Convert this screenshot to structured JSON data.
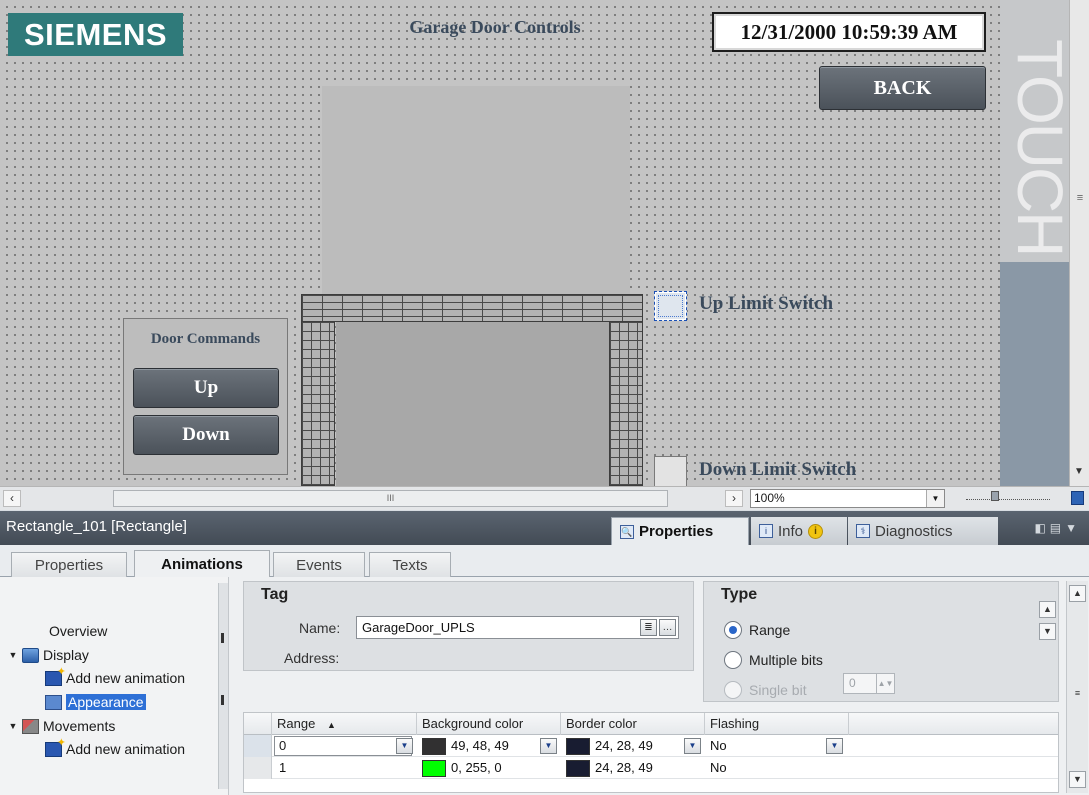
{
  "screen": {
    "logo_text": "SIEMENS",
    "title": "Garage Door Controls",
    "datetime": "12/31/2000 10:59:39 AM",
    "back_label": "BACK",
    "touch_label": "TOUCH",
    "door_commands": {
      "title": "Door Commands",
      "up_label": "Up",
      "down_label": "Down"
    },
    "up_limit_label": "Up Limit Switch",
    "down_limit_label": "Down Limit Switch"
  },
  "editor_bar": {
    "zoom": "100%",
    "grip": "III"
  },
  "inspector": {
    "object_title": "Rectangle_101 [Rectangle]",
    "tabs": [
      {
        "label": "Properties",
        "icon": "magnifier-properties-icon",
        "active": true
      },
      {
        "label": "Info",
        "icon": "info-icon",
        "badge": "i"
      },
      {
        "label": "Diagnostics",
        "icon": "diagnostics-icon"
      }
    ],
    "subtabs": [
      "Properties",
      "Animations",
      "Events",
      "Texts"
    ],
    "active_subtab": "Animations",
    "tree": {
      "overview": "Overview",
      "display": "Display",
      "display_add": "Add new animation",
      "appearance": "Appearance",
      "movements": "Movements",
      "movements_add": "Add new animation"
    },
    "tag_group": {
      "title": "Tag",
      "name_label": "Name:",
      "name_value": "GarageDoor_UPLS",
      "address_label": "Address:"
    },
    "type_group": {
      "title": "Type",
      "options": [
        "Range",
        "Multiple bits",
        "Single bit"
      ],
      "selected": "Range",
      "single_bit_value": "0"
    },
    "grid": {
      "columns": [
        "Range",
        "Background color",
        "Border color",
        "Flashing"
      ],
      "rows": [
        {
          "range": "0",
          "bg_color": "49, 48, 49",
          "bg_hex": "#313031",
          "border_color": "24, 28, 49",
          "border_hex": "#181c31",
          "flashing": "No"
        },
        {
          "range": "1",
          "bg_color": "0, 255, 0",
          "bg_hex": "#00ff00",
          "border_color": "24, 28, 49",
          "border_hex": "#181c31",
          "flashing": "No"
        }
      ]
    }
  },
  "colors": {
    "logo_bg": "#2f7a7a",
    "accent": "#2e70d6",
    "hmi_button": "#5a6169"
  }
}
